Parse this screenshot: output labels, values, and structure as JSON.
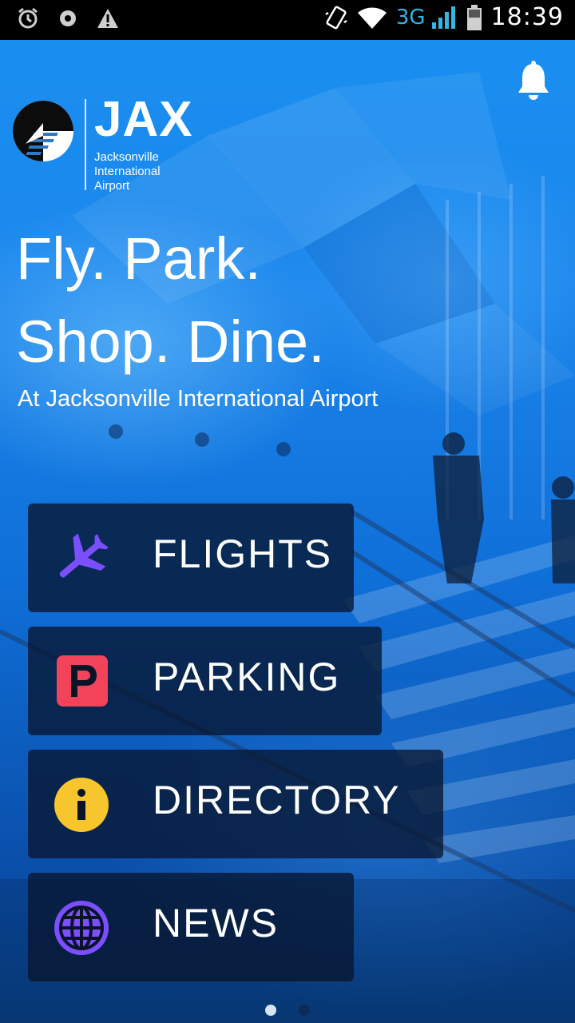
{
  "status_bar": {
    "network": "3G",
    "time": "18:39",
    "icons": [
      "alarm-icon",
      "sync-icon",
      "warning-icon",
      "vibrate-icon",
      "wifi-icon",
      "signal-icon",
      "battery-icon"
    ]
  },
  "header": {
    "bell_icon": "bell-icon",
    "logo": {
      "wordmark": "JAX",
      "subtitle_lines": [
        "Jacksonville",
        "International",
        "Airport"
      ]
    }
  },
  "hero": {
    "headline_lines": [
      "Fly. Park.",
      "Shop. Dine."
    ],
    "subheadline": "At Jacksonville International Airport"
  },
  "menu": {
    "items": [
      {
        "label": "FLIGHTS",
        "icon": "airplane-icon",
        "icon_color": "#7b4fff"
      },
      {
        "label": "PARKING",
        "icon": "parking-icon",
        "icon_color": "#f2435b"
      },
      {
        "label": "DIRECTORY",
        "icon": "info-icon",
        "icon_color": "#f7c52c"
      },
      {
        "label": "NEWS",
        "icon": "globe-icon",
        "icon_color": "#7b4fff"
      }
    ]
  },
  "pager": {
    "count": 2,
    "active_index": 0
  },
  "colors": {
    "button_bg": "rgba(8,22,48,0.78)",
    "hero_blue": "#1a8ff0",
    "status_3g": "#33b5e5"
  }
}
